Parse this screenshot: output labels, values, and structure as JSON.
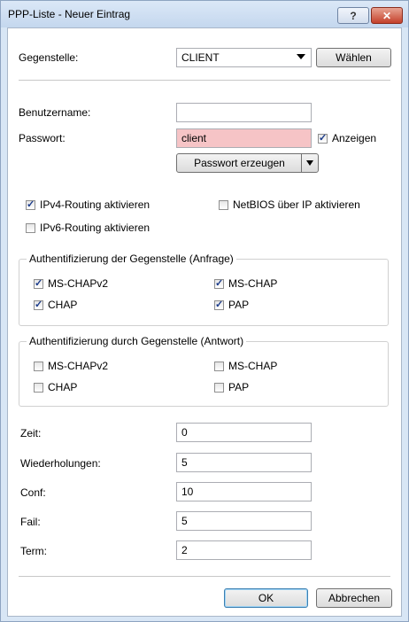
{
  "window": {
    "title": "PPP-Liste - Neuer Eintrag",
    "help_label": "?",
    "close_label": "✕"
  },
  "gegenstelle": {
    "label": "Gegenstelle:",
    "value": "CLIENT",
    "choose_label": "Wählen"
  },
  "credentials": {
    "username_label": "Benutzername:",
    "username_value": "",
    "password_label": "Passwort:",
    "password_value": "client",
    "show_label": "Anzeigen",
    "show_checked": true,
    "generate_label": "Passwort erzeugen"
  },
  "routing": {
    "ipv4_label": "IPv4-Routing aktivieren",
    "ipv4_checked": true,
    "netbios_label": "NetBIOS über IP aktivieren",
    "netbios_checked": false,
    "ipv6_label": "IPv6-Routing aktivieren",
    "ipv6_checked": false
  },
  "auth_request": {
    "title": "Authentifizierung der Gegenstelle (Anfrage)",
    "mschapv2_label": "MS-CHAPv2",
    "mschapv2_checked": true,
    "mschap_label": "MS-CHAP",
    "mschap_checked": true,
    "chap_label": "CHAP",
    "chap_checked": true,
    "pap_label": "PAP",
    "pap_checked": true
  },
  "auth_response": {
    "title": "Authentifizierung durch Gegenstelle (Antwort)",
    "mschapv2_label": "MS-CHAPv2",
    "mschapv2_checked": false,
    "mschap_label": "MS-CHAP",
    "mschap_checked": false,
    "chap_label": "CHAP",
    "chap_checked": false,
    "pap_label": "PAP",
    "pap_checked": false
  },
  "timing": {
    "zeit_label": "Zeit:",
    "zeit_value": "0",
    "wiederholungen_label": "Wiederholungen:",
    "wiederholungen_value": "5",
    "conf_label": "Conf:",
    "conf_value": "10",
    "fail_label": "Fail:",
    "fail_value": "5",
    "term_label": "Term:",
    "term_value": "2"
  },
  "footer": {
    "ok_label": "OK",
    "cancel_label": "Abbrechen"
  }
}
